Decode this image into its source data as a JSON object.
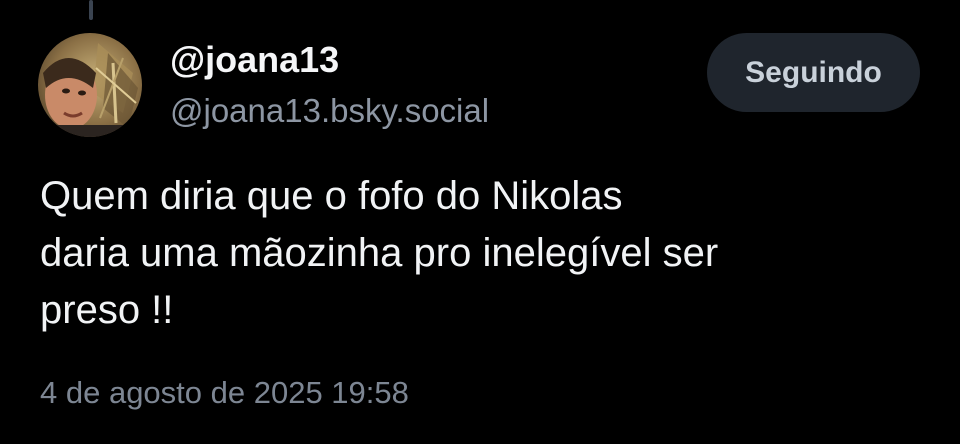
{
  "post": {
    "author": {
      "display_name": "@joana13",
      "handle": "@joana13.bsky.social",
      "avatar_icon": "user-avatar-photo"
    },
    "follow_button_label": "Seguindo",
    "text": "Quem diria que o fofo do Nikolas\ndaria uma mãozinha pro inelegível ser\npreso !!",
    "timestamp": "4 de agosto de 2025 19:58"
  },
  "colors": {
    "background": "#000000",
    "primary_text": "#f1f3f5",
    "secondary_text": "#8d96a3",
    "button_background": "#1f252d",
    "button_text": "#c9d1da"
  }
}
